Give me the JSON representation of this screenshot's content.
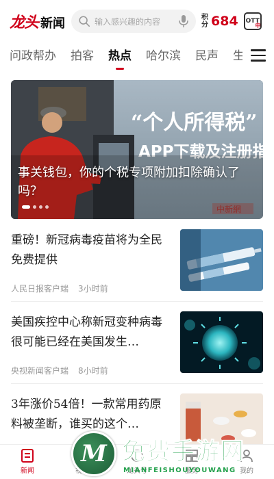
{
  "header": {
    "logo_brand": "龙头",
    "logo_text": "新闻",
    "search_placeholder": "输入感兴趣的内容",
    "points_label": "积分",
    "points_value": "684",
    "badge_text": "OTT",
    "badge_sub": "中"
  },
  "tabs": [
    {
      "label": "问政帮办"
    },
    {
      "label": "拍客"
    },
    {
      "label": "热点",
      "active": true
    },
    {
      "label": "哈尔滨"
    },
    {
      "label": "民声"
    },
    {
      "label": "生"
    }
  ],
  "hero": {
    "title": "事关钱包，你的个税专项附加扣除确认了吗？",
    "image_sign_line1": "“个人所得税”",
    "image_sign_line2": "APP下载及注册指引",
    "image_mark": "中新網"
  },
  "news": [
    {
      "title": "重磅！新冠病毒疫苗将为全民免费提供",
      "source": "人民日报客户端",
      "time": "3小时前",
      "thumb": "vaccine-syringe-image"
    },
    {
      "title": "美国疾控中心称新冠变种病毒很可能已经在美国发生…",
      "source": "央视新闻客户端",
      "time": "8小时前",
      "thumb": "virus-image"
    },
    {
      "title": "3年涨价54倍！一款常用药原料被垄断，谁买的这个…",
      "thumb": "pills-image"
    }
  ],
  "bottom_nav": [
    {
      "label": "新闻",
      "icon": "news-icon",
      "active": true
    },
    {
      "label": "视频",
      "icon": "video-icon"
    },
    {
      "label": "龙头号",
      "icon": "account-icon"
    },
    {
      "label": "服务",
      "icon": "service-icon"
    },
    {
      "label": "我的",
      "icon": "profile-icon"
    }
  ],
  "watermark": {
    "logo_letter": "M",
    "title": "免费手游网",
    "subtitle": "MIANFEISHOUYOUWANG"
  },
  "colors": {
    "accent": "#d0021b",
    "watermark_green": "#22a04b"
  }
}
